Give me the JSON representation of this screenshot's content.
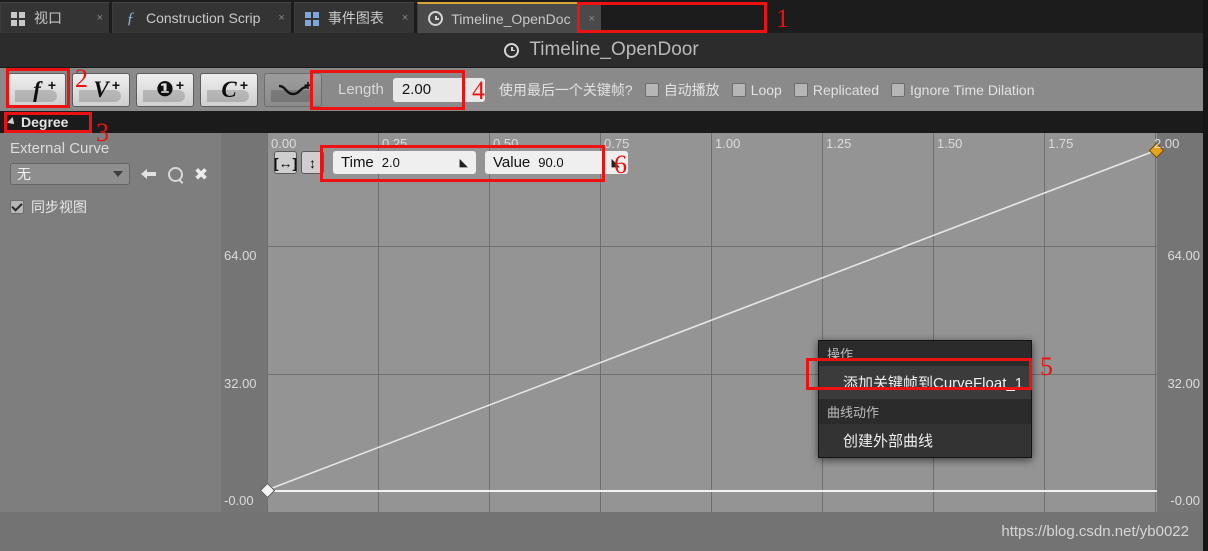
{
  "tabs": [
    {
      "label": "视口",
      "icon": "grid-icon",
      "close": "×",
      "active": false
    },
    {
      "label": "Construction Scrip",
      "icon": "function-icon",
      "close": "×",
      "active": false
    },
    {
      "label": "事件图表",
      "icon": "grid-blue-icon",
      "close": "×",
      "active": false
    },
    {
      "label": "Timeline_OpenDoc",
      "icon": "clock-icon",
      "close": "×",
      "active": true
    }
  ],
  "titlebar": {
    "title": "Timeline_OpenDoor",
    "icon": "clock-icon"
  },
  "toolbar": {
    "buttons": [
      {
        "name": "add-float-track",
        "glyph": "f",
        "plus": "+",
        "dim": false
      },
      {
        "name": "add-vector-track",
        "glyph": "V",
        "plus": "+",
        "dim": false
      },
      {
        "name": "add-event-track",
        "glyph": "❶",
        "plus": "+",
        "dim": false
      },
      {
        "name": "add-color-track",
        "glyph": "C",
        "plus": "+",
        "dim": false
      },
      {
        "name": "add-external-curve-track",
        "glyph": "~",
        "plus": "+",
        "dim": true
      }
    ],
    "length_label": "Length",
    "length_value": "2.00",
    "use_last_keyframe_label": "使用最后一个关键帧?",
    "options": [
      {
        "label": "自动播放",
        "checked": false
      },
      {
        "label": "Loop",
        "checked": false
      },
      {
        "label": "Replicated",
        "checked": false
      },
      {
        "label": "Ignore Time Dilation",
        "checked": false
      }
    ]
  },
  "track": {
    "name": "Degree",
    "external_curve_label": "External Curve",
    "external_curve_value": "无",
    "sync_view_label": "同步视图",
    "sync_view_checked": true
  },
  "fit": {
    "horizontal": "[↔]",
    "vertical": "↕"
  },
  "fields": {
    "time_label": "Time",
    "time_value": "2.0",
    "value_label": "Value",
    "value_value": "90.0"
  },
  "context_menu": {
    "section1": "操作",
    "item1": "添加关键帧到CurveFloat_1",
    "section2": "曲线动作",
    "item2": "创建外部曲线"
  },
  "footer": {
    "watermark": "https://blog.csdn.net/yb0022"
  },
  "annotations": [
    {
      "num": "1"
    },
    {
      "num": "2"
    },
    {
      "num": "3"
    },
    {
      "num": "4"
    },
    {
      "num": "5"
    },
    {
      "num": "6"
    }
  ],
  "chart_data": {
    "type": "line",
    "title": "Degree",
    "xlabel": "Time",
    "ylabel": "Value",
    "xlim": [
      0,
      2.0
    ],
    "ylim": [
      0,
      90
    ],
    "xticks": [
      "0.00",
      "0.25",
      "0.50",
      "0.75",
      "1.00",
      "1.25",
      "1.50",
      "1.75",
      "2.00"
    ],
    "yticks_left": [
      "64.00",
      "32.00",
      "-0.00"
    ],
    "yticks_right": [
      "64.00",
      "32.00",
      "-0.00"
    ],
    "grid": true,
    "legend": "none",
    "series": [
      {
        "name": "CurveFloat_1",
        "points": [
          {
            "time": 0.0,
            "value": 0.0
          },
          {
            "time": 2.0,
            "value": 90.0
          }
        ],
        "color": "#f2f2f2",
        "interpolation": "linear"
      }
    ],
    "keys": [
      {
        "time": 0.0,
        "value": 0.0,
        "selected": false
      },
      {
        "time": 2.0,
        "value": 90.0,
        "selected": true
      }
    ]
  }
}
